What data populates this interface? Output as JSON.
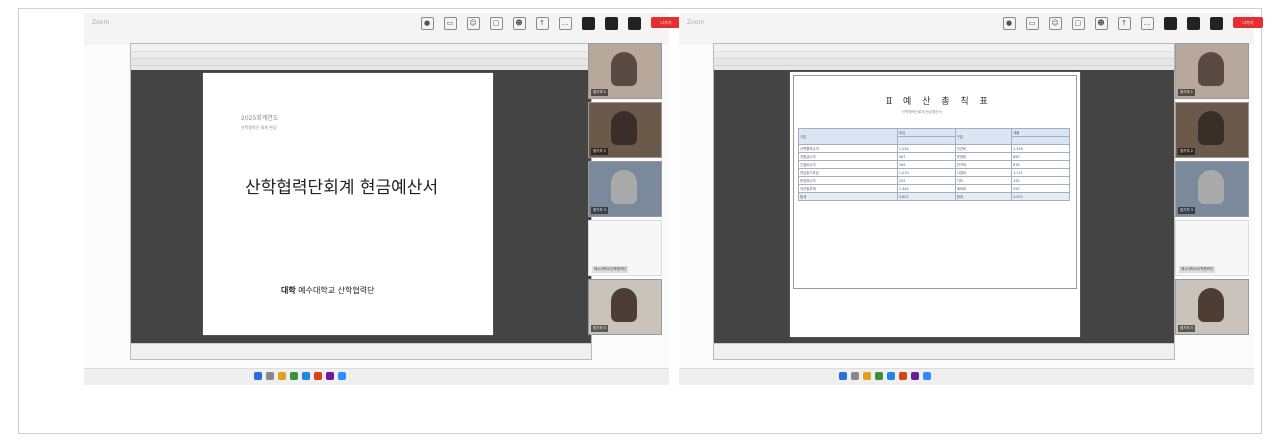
{
  "left": {
    "window_title": "Zoom",
    "slide": {
      "year_label": "2025회계연도",
      "sub_label": "산학협력단 회계 편성",
      "title": "산학협력단회계 현금예산서",
      "logo_mark": "대학",
      "footer": "예수대학교 산학협력단"
    },
    "participants": [
      "참가자 1",
      "참가자 2",
      "참가자 3",
      "예수대학교산학협력단",
      "참가자 5"
    ],
    "leave_label": "나가기"
  },
  "right": {
    "window_title": "Zoom",
    "doc": {
      "title": "Ⅱ 예 산 총 칙 표",
      "subtitle": "산학협력단회계 현금예산서",
      "headers": [
        "구분",
        "세입",
        "세출"
      ],
      "rows": [
        [
          "산학협력수익",
          "1,234",
          "인건비",
          "2,345"
        ],
        [
          "지원금수익",
          "567",
          "운영비",
          "890"
        ],
        [
          "간접비수익",
          "345",
          "연구비",
          "678"
        ],
        [
          "전입및기부금",
          "1,010",
          "사업비",
          "1,121"
        ],
        [
          "운영외수익",
          "222",
          "기타",
          "333"
        ],
        [
          "자산및부채",
          "1,444",
          "예비비",
          "555"
        ]
      ],
      "total": [
        "합계",
        "4,822",
        "합계",
        "5,922"
      ]
    },
    "participants": [
      "참가자 1",
      "참가자 2",
      "참가자 3",
      "예수대학교산학협력단",
      "참가자 5"
    ],
    "leave_label": "나가기"
  },
  "colors": {
    "leave": "#e23030",
    "slide_bg": "#444444",
    "table_header": "#dbe6f4"
  }
}
